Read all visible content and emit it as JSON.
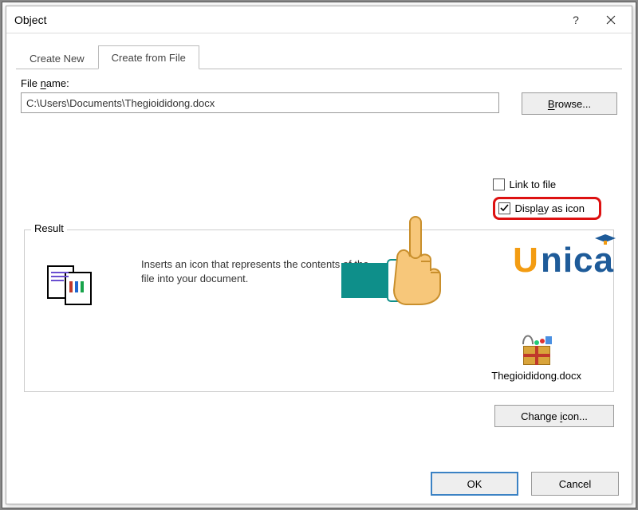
{
  "titlebar": {
    "title": "Object"
  },
  "tabs": {
    "create_new": "Create New",
    "create_from_file": "Create from File"
  },
  "file": {
    "label": "File name:",
    "value": "C:\\Users\\Documents\\Thegioididong.docx",
    "browse": "Browse..."
  },
  "options": {
    "link_to_file": "Link to file",
    "display_as_icon": "Display as icon"
  },
  "result": {
    "legend": "Result",
    "text": "Inserts an icon that represents the contents of the file into your document."
  },
  "preview": {
    "filename": "Thegioididong.docx"
  },
  "buttons": {
    "change_icon": "Change icon...",
    "ok": "OK",
    "cancel": "Cancel"
  }
}
